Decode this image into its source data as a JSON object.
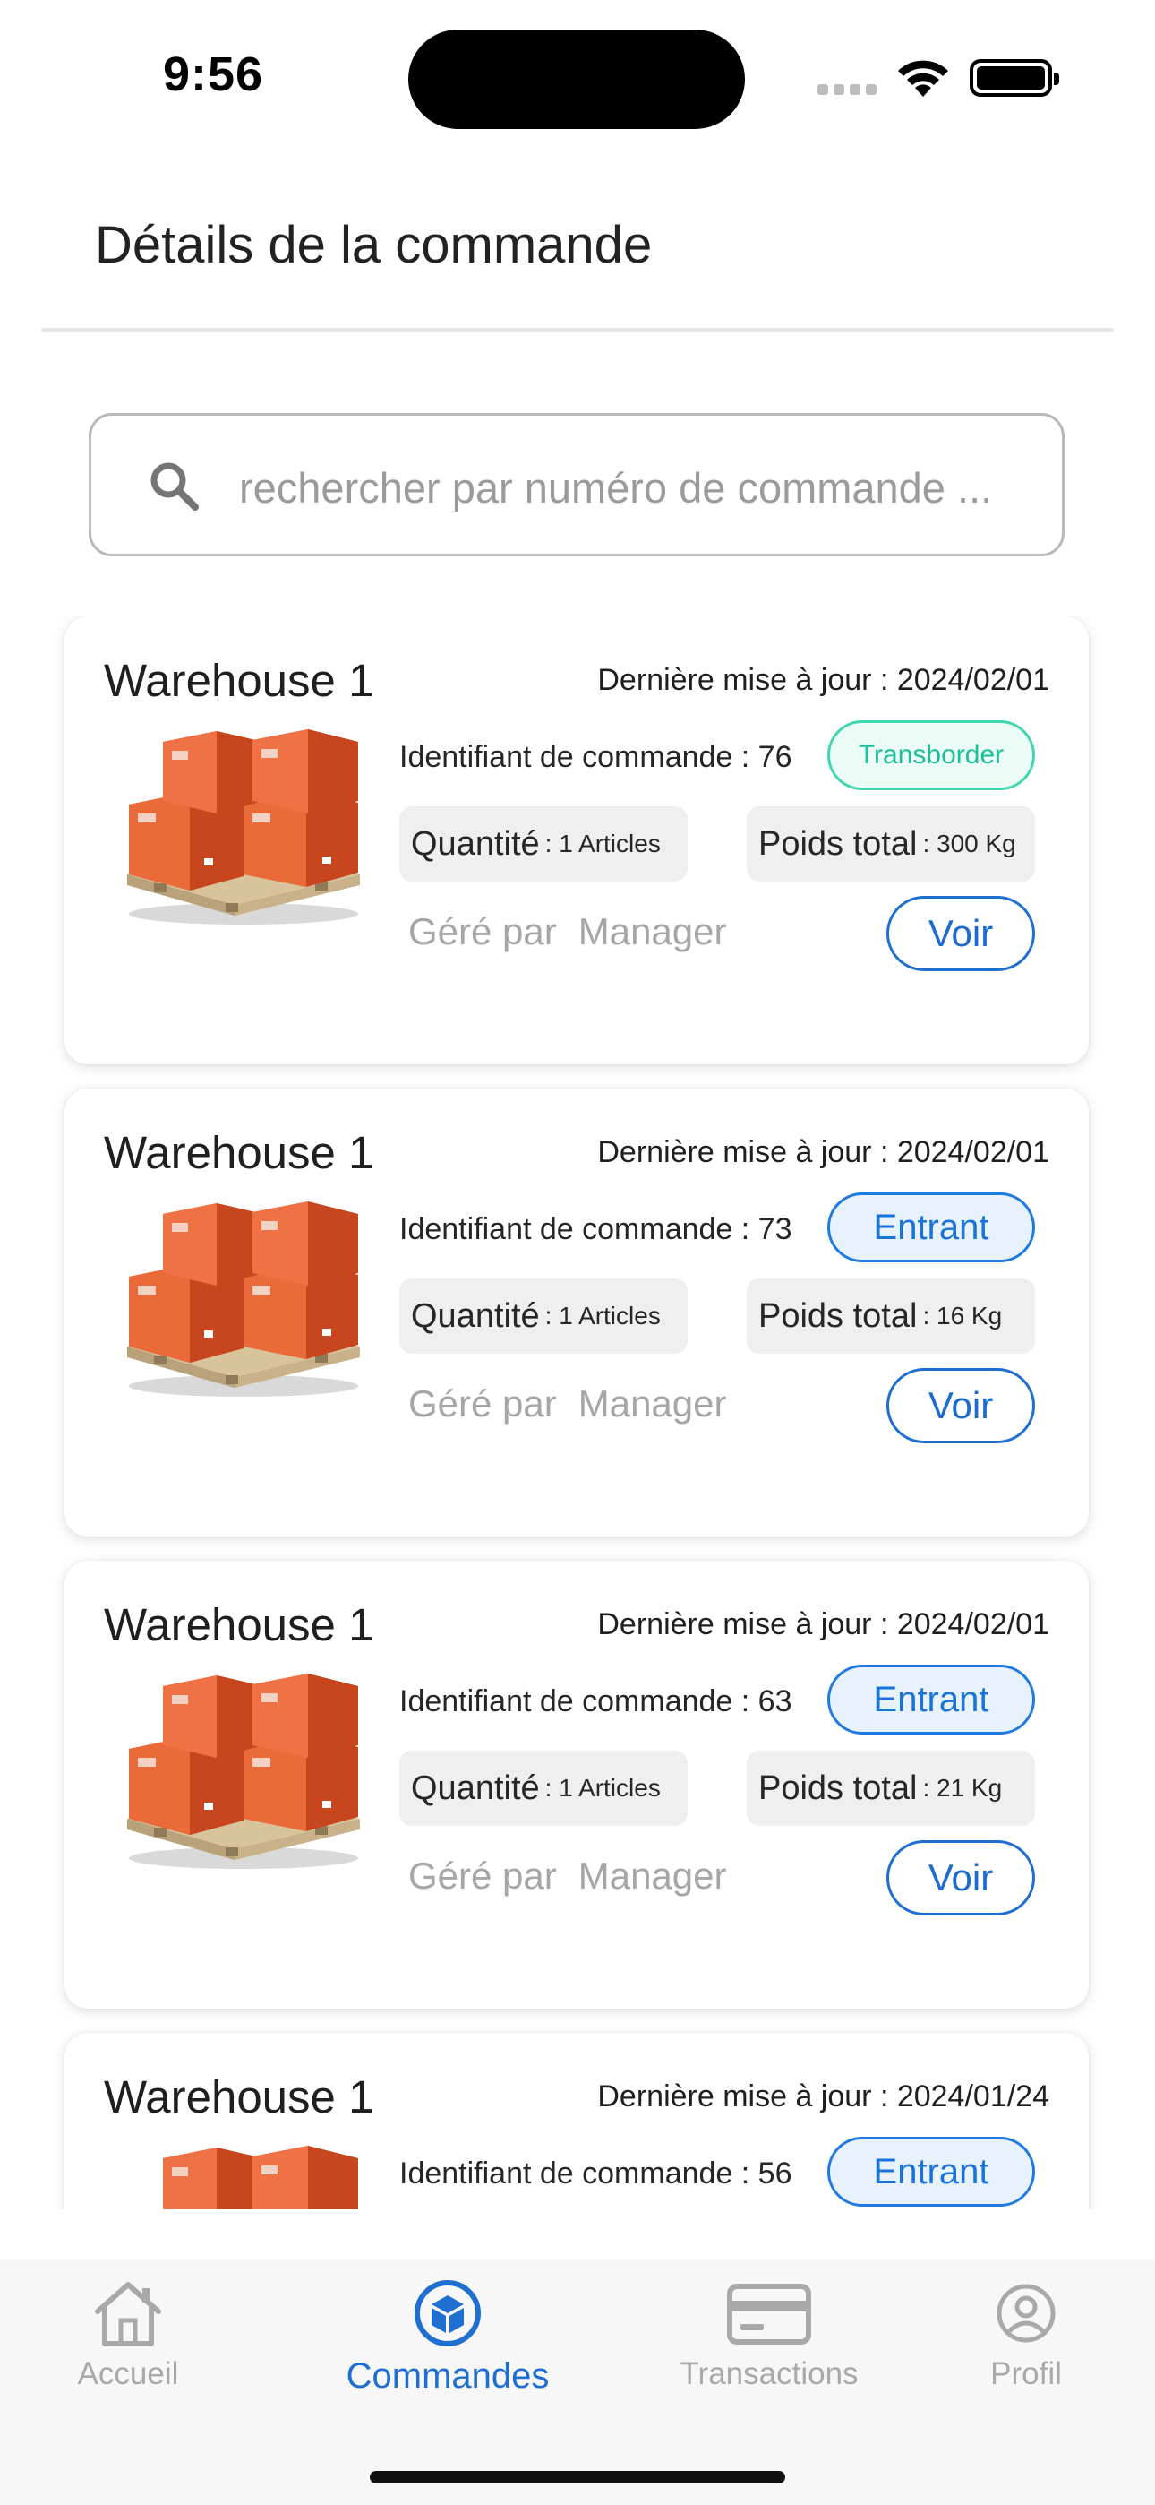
{
  "status_bar": {
    "time": "9:56"
  },
  "header": {
    "title": "Détails de la commande"
  },
  "search": {
    "placeholder": "rechercher par numéro de commande ..."
  },
  "orders": [
    {
      "warehouse": "Warehouse 1",
      "updated": "Dernière mise à jour : 2024/02/01",
      "order_id": "Identifiant de commande : 76",
      "status": "Transborder",
      "quantity_key": "Quantité",
      "quantity_value": ": 1 Articles",
      "weight_key": "Poids total",
      "weight_value": ": 300 Kg",
      "managed_by": "Géré par",
      "manager": "Manager",
      "action": "Voir"
    },
    {
      "warehouse": "Warehouse 1",
      "updated": "Dernière mise à jour : 2024/02/01",
      "order_id": "Identifiant de commande : 73",
      "status": "Entrant",
      "quantity_key": "Quantité",
      "quantity_value": ": 1 Articles",
      "weight_key": "Poids total",
      "weight_value": ": 16 Kg",
      "managed_by": "Géré par",
      "manager": "Manager",
      "action": "Voir"
    },
    {
      "warehouse": "Warehouse 1",
      "updated": "Dernière mise à jour : 2024/02/01",
      "order_id": "Identifiant de commande : 63",
      "status": "Entrant",
      "quantity_key": "Quantité",
      "quantity_value": ": 1 Articles",
      "weight_key": "Poids total",
      "weight_value": ": 21 Kg",
      "managed_by": "Géré par",
      "manager": "Manager",
      "action": "Voir"
    },
    {
      "warehouse": "Warehouse 1",
      "updated": "Dernière mise à jour : 2024/01/24",
      "order_id": "Identifiant de commande : 56",
      "status": "Entrant"
    }
  ],
  "tabs": [
    {
      "label": "Accueil",
      "icon": "home-icon",
      "active": false
    },
    {
      "label": "Commandes",
      "icon": "package-icon",
      "active": true
    },
    {
      "label": "Transactions",
      "icon": "credit-card-icon",
      "active": false
    },
    {
      "label": "Profil",
      "icon": "user-circle-icon",
      "active": false
    }
  ],
  "colors": {
    "accent": "#1f6fd1",
    "transborder": "#1cbf98",
    "box_orange": "#e8542a"
  }
}
